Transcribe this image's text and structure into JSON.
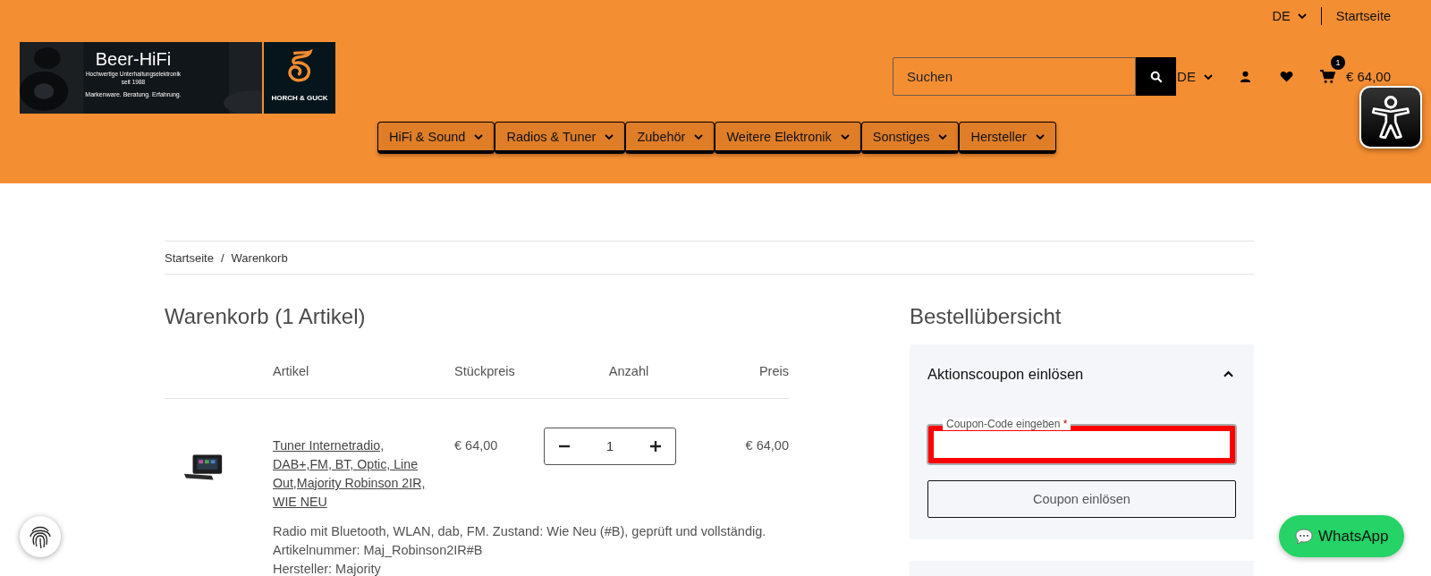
{
  "top_bar": {
    "language": "DE",
    "link": "Startseite"
  },
  "logo": {
    "title": "Beer-HiFi",
    "tagline": "Hochwertige Unterhaltungselektronik",
    "since": "seit 1988",
    "slogan": "Markenware.  Beratung.  Erfahrung.",
    "brand": "HORCH & GUCK"
  },
  "search": {
    "placeholder": "Suchen"
  },
  "header_actions": {
    "language": "DE",
    "cart_count": "1",
    "cart_total": "€ 64,00"
  },
  "nav": [
    "HiFi & Sound",
    "Radios & Tuner",
    "Zubehör",
    "Weitere Elektronik",
    "Sonstiges",
    "Hersteller"
  ],
  "breadcrumb": {
    "items": [
      "Startseite",
      "Warenkorb"
    ],
    "separator": "/"
  },
  "cart": {
    "title": "Warenkorb (1 Artikel)",
    "columns": [
      "Artikel",
      "Stückpreis",
      "Anzahl",
      "Preis"
    ],
    "items": [
      {
        "name": "Tuner Internetradio, DAB+,FM, BT, Optic, Line Out,Majority Robinson 2IR, WIE NEU",
        "unit_price": "€ 64,00",
        "quantity": "1",
        "price": "€ 64,00",
        "details": [
          "Radio mit Bluetooth, WLAN, dab, FM. Zustand: Wie Neu (#B), geprüft und vollständig.",
          "Artikelnummer: Maj_Robinson2IR#B",
          "Hersteller: Majority"
        ]
      }
    ]
  },
  "summary": {
    "title": "Bestellübersicht",
    "coupon": {
      "title": "Aktionscoupon einlösen",
      "expanded": true,
      "field_label": "Coupon-Code eingeben",
      "required_mark": "*",
      "error": true,
      "button": "Coupon einlösen"
    }
  },
  "whatsapp": {
    "label": "WhatsApp"
  }
}
